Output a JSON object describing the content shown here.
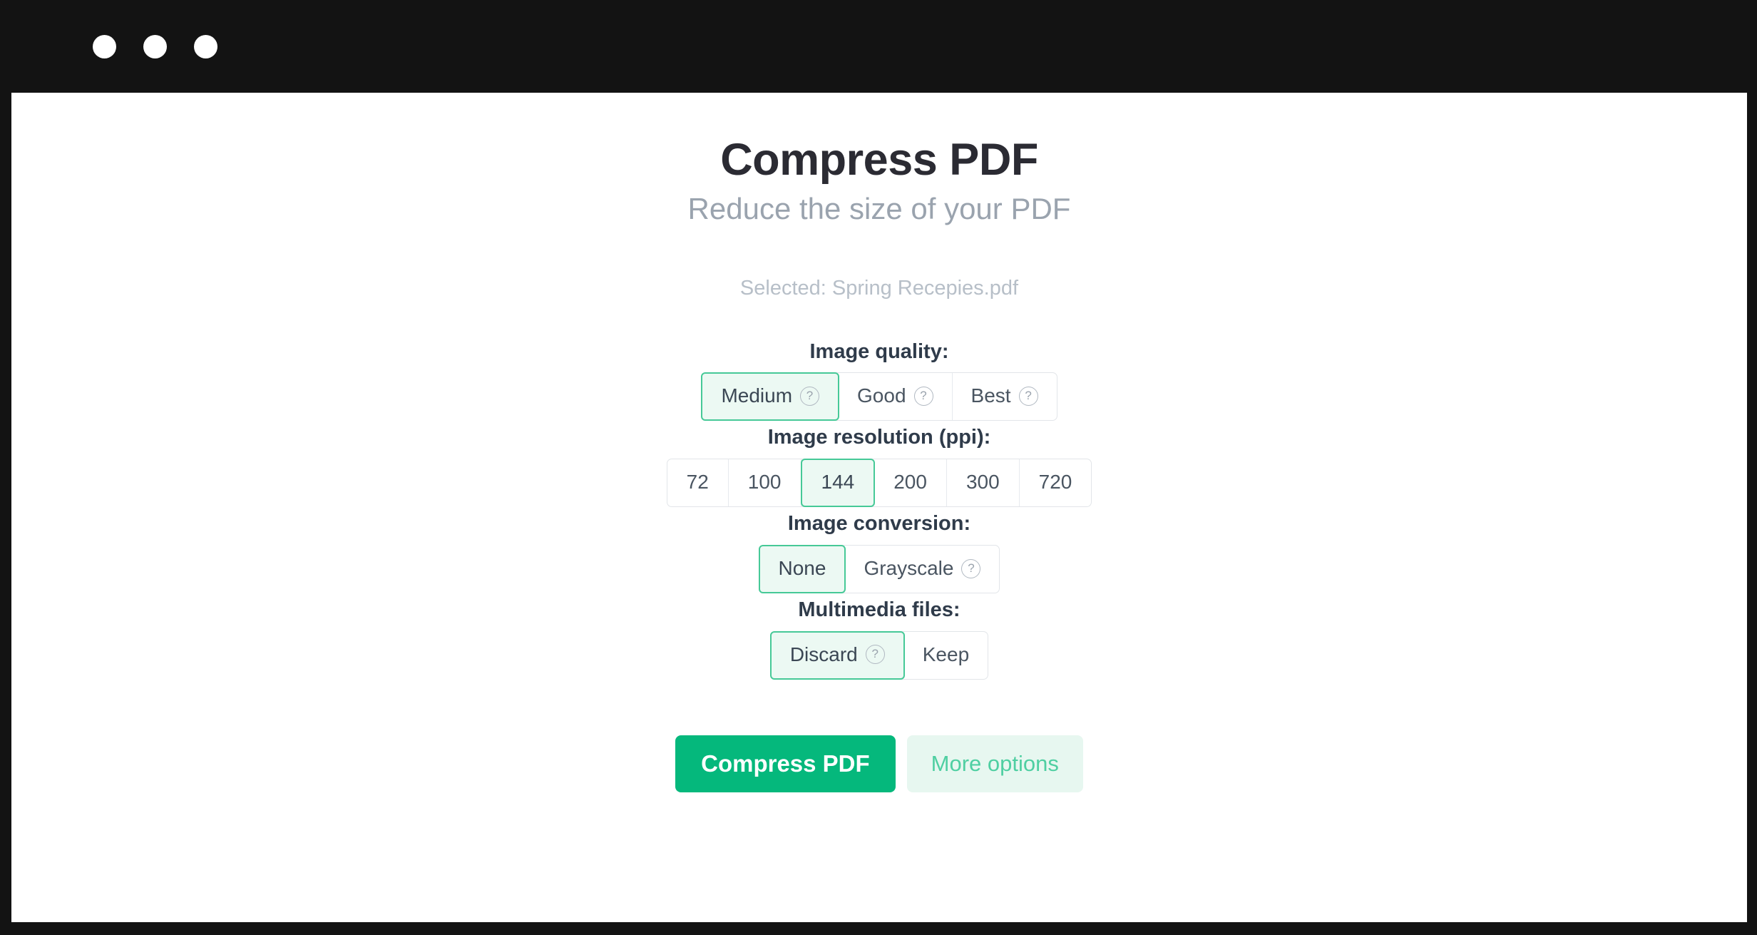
{
  "window": {
    "controls": [
      "window-dot-1",
      "window-dot-2",
      "window-dot-3"
    ]
  },
  "header": {
    "title": "Compress PDF",
    "subtitle": "Reduce the size of your PDF",
    "selected_file": "Selected: Spring Recepies.pdf"
  },
  "colors": {
    "accent_green": "#05b87c",
    "selected_border": "#46c997",
    "selected_background": "#ecf9f3",
    "ghost_background": "#e7f7f0",
    "ghost_text": "#4fcfa2",
    "heading_text": "#2f3b4a",
    "muted_text": "#b7bfc8",
    "titlebar": "#131313"
  },
  "options": [
    {
      "id": "image-quality",
      "label": "Image quality:",
      "choices": [
        {
          "label": "Medium",
          "selected": true,
          "help": true
        },
        {
          "label": "Good",
          "selected": false,
          "help": true
        },
        {
          "label": "Best",
          "selected": false,
          "help": true
        }
      ]
    },
    {
      "id": "image-resolution",
      "label": "Image resolution (ppi):",
      "choices": [
        {
          "label": "72",
          "selected": false,
          "help": false
        },
        {
          "label": "100",
          "selected": false,
          "help": false
        },
        {
          "label": "144",
          "selected": true,
          "help": false
        },
        {
          "label": "200",
          "selected": false,
          "help": false
        },
        {
          "label": "300",
          "selected": false,
          "help": false
        },
        {
          "label": "720",
          "selected": false,
          "help": false
        }
      ]
    },
    {
      "id": "image-conversion",
      "label": "Image conversion:",
      "choices": [
        {
          "label": "None",
          "selected": true,
          "help": false
        },
        {
          "label": "Grayscale",
          "selected": false,
          "help": true
        }
      ]
    },
    {
      "id": "multimedia-files",
      "label": "Multimedia files:",
      "choices": [
        {
          "label": "Discard",
          "selected": true,
          "help": true
        },
        {
          "label": "Keep",
          "selected": false,
          "help": false
        }
      ]
    }
  ],
  "actions": {
    "primary_label": "Compress PDF",
    "secondary_label": "More options"
  },
  "icons": {
    "help": "?"
  }
}
